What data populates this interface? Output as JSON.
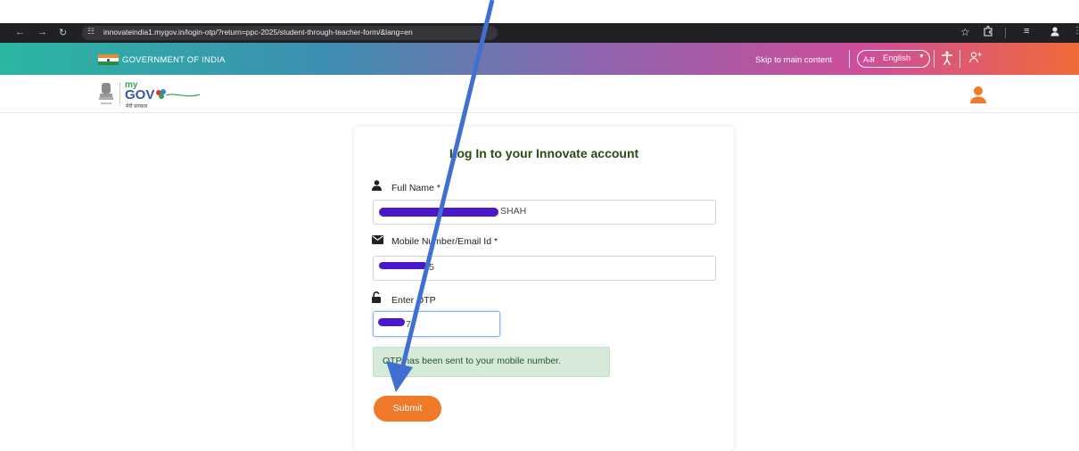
{
  "browser": {
    "url": "innovateindia1.mygov.in/login-otp/?return=ppc-2025/student-through-teacher-form/&lang=en",
    "back_icon": "arrow-left-icon",
    "forward_icon": "arrow-right-icon",
    "reload_icon": "reload-icon",
    "site_info_icon": "tune-icon",
    "star_icon": "star-icon",
    "extensions_icon": "puzzle-icon",
    "reading_list_icon": "reading-list-icon",
    "profile_icon": "profile-icon"
  },
  "govbar": {
    "title": "GOVERNMENT OF INDIA",
    "skip_link": "Skip to main content",
    "language": "English",
    "lang_icon_text": "Aअ",
    "accessibility_icon": "accessibility-icon",
    "login_icon": "user-plus-icon"
  },
  "header": {
    "logo_my": "my",
    "logo_gov": "GOV",
    "logo_hindi": "मेरी सरकार"
  },
  "form": {
    "title": "Log In to your Innovate account",
    "full_name_label": "Full Name *",
    "full_name_value_suffix": "SHAH",
    "mobile_label": "Mobile Number/Email Id *",
    "mobile_value_suffix": "5",
    "otp_label": "Enter OTP",
    "otp_value_suffix": "7",
    "alert": "OTP has been sent to your mobile number.",
    "submit_label": "Submit"
  },
  "colors": {
    "accent": "#f07a2a",
    "title_green": "#2d4a14",
    "redaction": "#4a17c9",
    "arrow": "#3e6fd1",
    "alert_bg": "#d5ead9"
  }
}
